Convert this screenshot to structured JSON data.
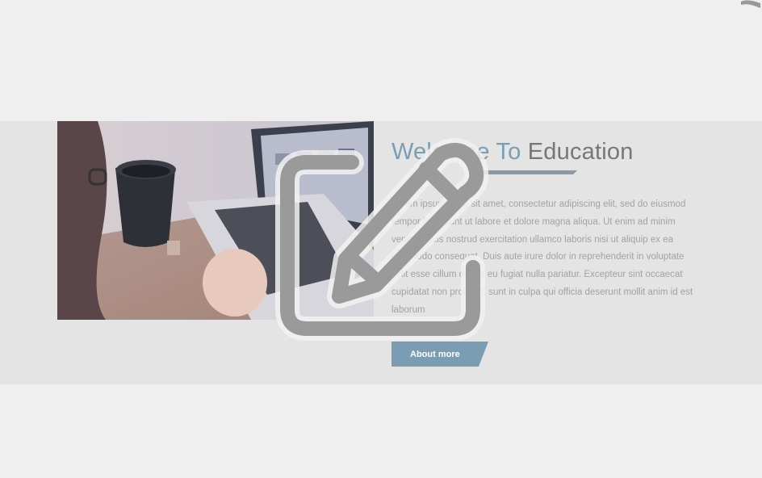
{
  "welcome": {
    "heading_accent": "Welcome To",
    "heading_main": "Education",
    "body": "Lorem ipsum dolor sit amet, consectetur adipiscing elit, sed do eiusmod tempor incididunt ut labore et dolore magna aliqua. Ut enim ad minim veniam, quis nostrud exercitation ullamco laboris nisi ut aliquip ex ea commodo consequat. Duis aute irure dolor in reprehenderit in voluptate velit esse cillum dolore eu fugiat nulla pariatur. Excepteur sint occaecat cupidatat non proident, sunt in culpa qui officia deserunt mollit anim id est laborum",
    "button_label": "About more"
  },
  "icons": {
    "overlay": "edit-pencil-icon",
    "photo": "laptop-coffee-photo"
  },
  "colors": {
    "accent": "#7a9db4",
    "heading_gray": "#777777",
    "section_bg": "#e4e4e4",
    "page_bg": "#efefef"
  }
}
